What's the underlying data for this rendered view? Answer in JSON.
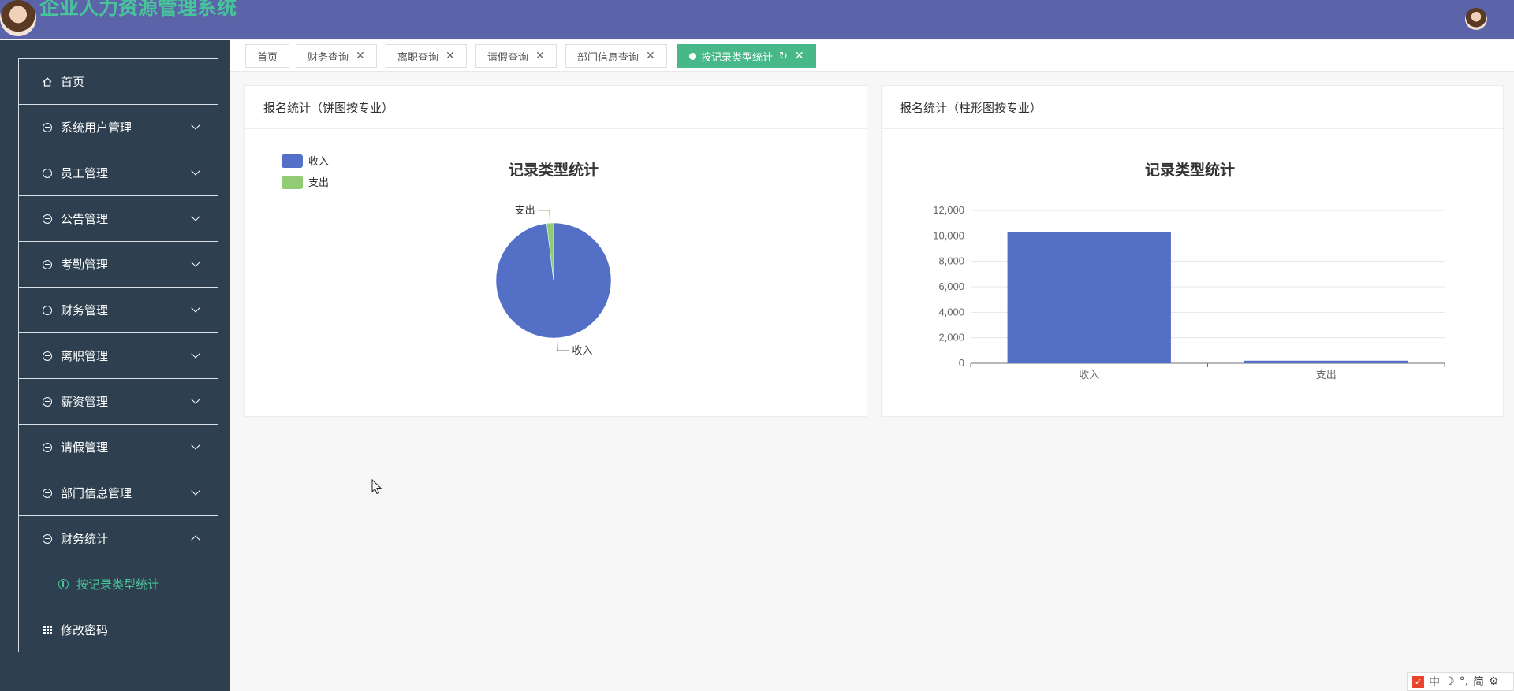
{
  "header": {
    "title": "企业人力资源管理系统"
  },
  "sidebar": {
    "items": [
      {
        "label": "首页",
        "icon": "home-icon"
      },
      {
        "label": "系统用户管理",
        "icon": "circle-minus-icon"
      },
      {
        "label": "员工管理",
        "icon": "circle-minus-icon"
      },
      {
        "label": "公告管理",
        "icon": "circle-minus-icon"
      },
      {
        "label": "考勤管理",
        "icon": "circle-minus-icon"
      },
      {
        "label": "财务管理",
        "icon": "circle-minus-icon"
      },
      {
        "label": "离职管理",
        "icon": "circle-minus-icon"
      },
      {
        "label": "薪资管理",
        "icon": "circle-minus-icon"
      },
      {
        "label": "请假管理",
        "icon": "circle-minus-icon"
      },
      {
        "label": "部门信息管理",
        "icon": "circle-minus-icon"
      },
      {
        "label": "财务统计",
        "icon": "circle-minus-icon",
        "expanded": true
      },
      {
        "label": "修改密码",
        "icon": "grid-icon"
      }
    ],
    "subitem": {
      "label": "按记录类型统计",
      "icon": "chart-icon"
    }
  },
  "tabs": [
    {
      "label": "首页",
      "closable": false
    },
    {
      "label": "财务查询",
      "closable": true
    },
    {
      "label": "离职查询",
      "closable": true
    },
    {
      "label": "请假查询",
      "closable": true
    },
    {
      "label": "部门信息查询",
      "closable": true
    },
    {
      "label": "按记录类型统计",
      "closable": true,
      "active": true
    }
  ],
  "cards": {
    "pie": {
      "header": "报名统计（饼图按专业）"
    },
    "bar": {
      "header": "报名统计（柱形图按专业）"
    }
  },
  "ime": {
    "lang": "中",
    "mode": "简"
  },
  "chart_data": [
    {
      "type": "pie",
      "title": "记录类型统计",
      "legend_position": "top-left",
      "slices": [
        {
          "name": "收入",
          "value": 10300,
          "color": "#5470c6"
        },
        {
          "name": "支出",
          "value": 200,
          "color": "#91cc75"
        }
      ]
    },
    {
      "type": "bar",
      "title": "记录类型统计",
      "categories": [
        "收入",
        "支出"
      ],
      "values": [
        10300,
        200
      ],
      "ylim": [
        0,
        12000
      ],
      "yticks": [
        "0",
        "2,000",
        "4,000",
        "6,000",
        "8,000",
        "10,000",
        "12,000"
      ],
      "color": "#5470c6",
      "grid": true
    }
  ]
}
